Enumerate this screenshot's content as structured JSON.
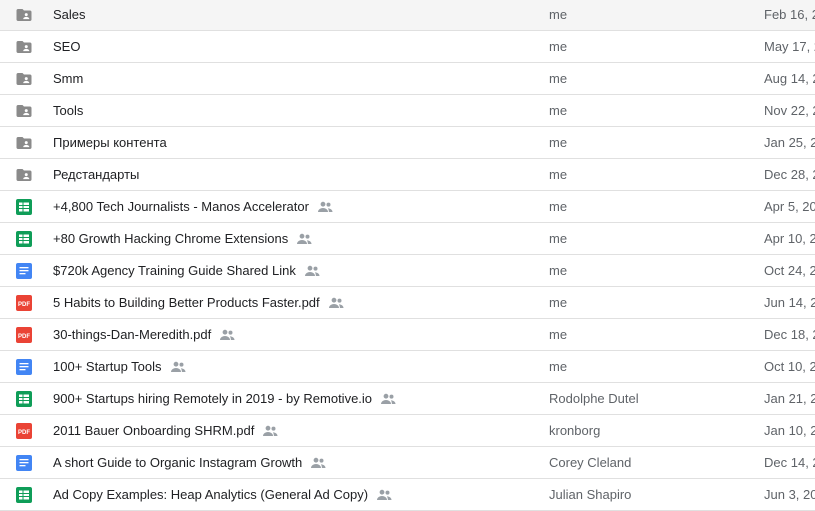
{
  "files": [
    {
      "type": "shared-folder",
      "icon": "shared-folder-icon",
      "name": "Sales",
      "shared": false,
      "owner": "me",
      "modified": "Feb 16, 2"
    },
    {
      "type": "shared-folder",
      "icon": "shared-folder-icon",
      "name": "SEO",
      "shared": false,
      "owner": "me",
      "modified": "May 17, 2"
    },
    {
      "type": "shared-folder",
      "icon": "shared-folder-icon",
      "name": "Smm",
      "shared": false,
      "owner": "me",
      "modified": "Aug 14, 2"
    },
    {
      "type": "shared-folder",
      "icon": "shared-folder-icon",
      "name": "Tools",
      "shared": false,
      "owner": "me",
      "modified": "Nov 22, 2"
    },
    {
      "type": "shared-folder",
      "icon": "shared-folder-icon",
      "name": "Примеры контента",
      "shared": false,
      "owner": "me",
      "modified": "Jan 25, 2"
    },
    {
      "type": "shared-folder",
      "icon": "shared-folder-icon",
      "name": "Редстандарты",
      "shared": false,
      "owner": "me",
      "modified": "Dec 28, 2"
    },
    {
      "type": "sheet",
      "icon": "google-sheets-icon",
      "name": "+4,800 Tech Journalists - Manos Accelerator",
      "shared": true,
      "owner": "me",
      "modified": "Apr 5, 20"
    },
    {
      "type": "sheet",
      "icon": "google-sheets-icon",
      "name": "+80 Growth Hacking Chrome Extensions",
      "shared": true,
      "owner": "me",
      "modified": "Apr 10, 2"
    },
    {
      "type": "doc",
      "icon": "google-docs-icon",
      "name": "$720k Agency Training Guide Shared Link",
      "shared": true,
      "owner": "me",
      "modified": "Oct 24, 2"
    },
    {
      "type": "pdf",
      "icon": "pdf-icon",
      "name": "5 Habits to Building Better Products Faster.pdf",
      "shared": true,
      "owner": "me",
      "modified": "Jun 14, 2"
    },
    {
      "type": "pdf",
      "icon": "pdf-icon",
      "name": "30-things-Dan-Meredith.pdf",
      "shared": true,
      "owner": "me",
      "modified": "Dec 18, 2"
    },
    {
      "type": "doc",
      "icon": "google-docs-icon",
      "name": "100+ Startup Tools",
      "shared": true,
      "owner": "me",
      "modified": "Oct 10, 2"
    },
    {
      "type": "sheet",
      "icon": "google-sheets-icon",
      "name": "900+ Startups hiring Remotely in 2019 - by Remotive.io",
      "shared": true,
      "owner": "Rodolphe Dutel",
      "modified": "Jan 21, 2"
    },
    {
      "type": "pdf",
      "icon": "pdf-icon",
      "name": "2011 Bauer Onboarding SHRM.pdf",
      "shared": true,
      "owner": "kronborg",
      "modified": "Jan 10, 2"
    },
    {
      "type": "doc",
      "icon": "google-docs-icon",
      "name": "A short Guide to Organic Instagram Growth",
      "shared": true,
      "owner": "Corey Cleland",
      "modified": "Dec 14, 2"
    },
    {
      "type": "sheet",
      "icon": "google-sheets-icon",
      "name": "Ad Copy Examples: Heap Analytics (General Ad Copy)",
      "shared": true,
      "owner": "Julian Shapiro",
      "modified": "Jun 3, 20"
    }
  ],
  "shared_icon": "people-icon",
  "colors": {
    "folder": "#8a8a8a",
    "sheets": "#0f9d58",
    "docs": "#4285f4",
    "pdf": "#ea4335",
    "shared_icon": "#9aa0a6",
    "text": "#202124",
    "secondary_text": "#5f6368",
    "divider": "#e0e0e0"
  },
  "labels": {
    "pdf_badge": "PDF"
  }
}
